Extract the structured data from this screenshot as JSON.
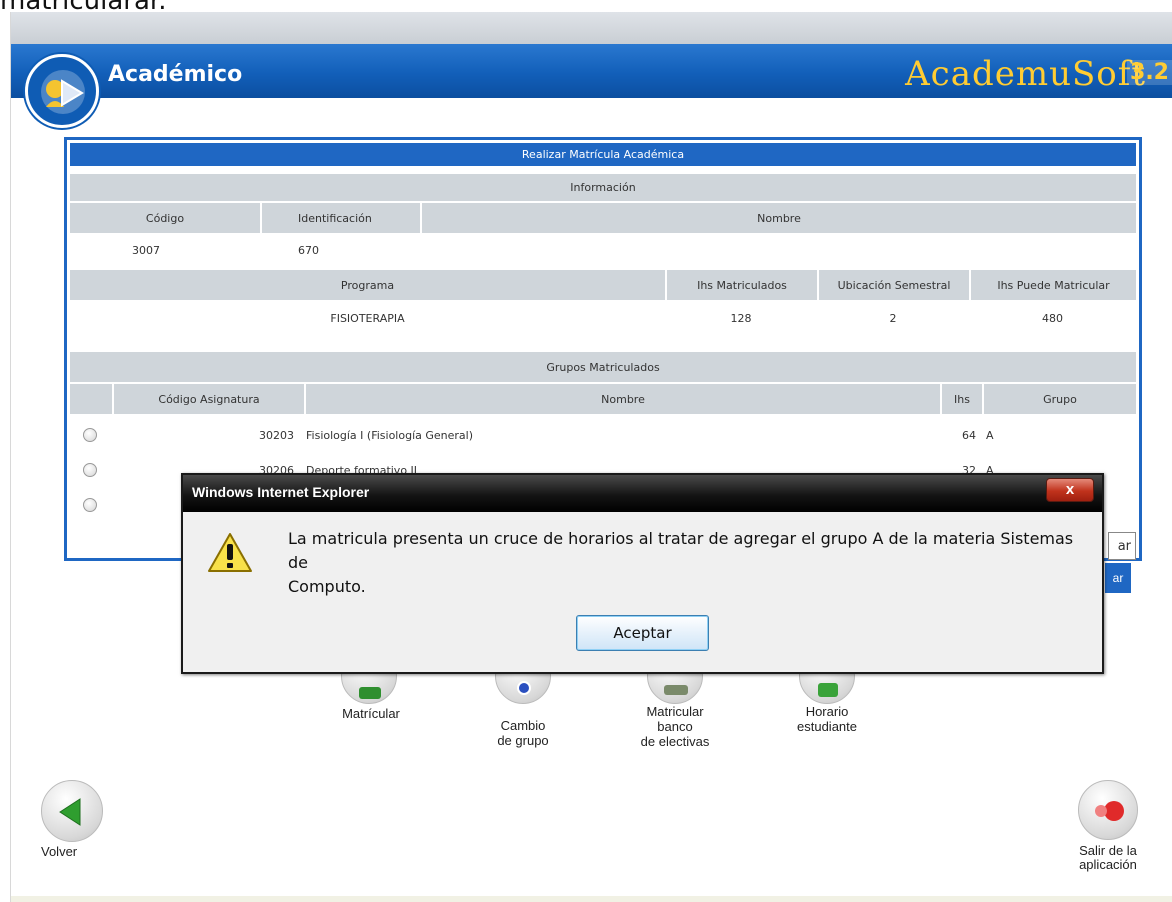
{
  "top_cut_text": "matricularar.",
  "header": {
    "title": "Académico",
    "brand": "AcademuSoft",
    "brand_version": "3.2"
  },
  "panel": {
    "title": "Realizar Matrícula Académica",
    "info_section": "Información",
    "columns_student": [
      "Código",
      "Identificación",
      "Nombre"
    ],
    "student": {
      "codigo": "3007",
      "identificacion": "670",
      "nombre": ""
    },
    "columns_program": [
      "Programa",
      "Ihs Matriculados",
      "Ubicación Semestral",
      "Ihs Puede Matricular"
    ],
    "program": {
      "programa": "FISIOTERAPIA",
      "ihs_matriculados": "128",
      "ubicacion": "2",
      "ihs_puede": "480"
    },
    "groups_section": "Grupos Matriculados",
    "columns_groups": [
      "Código Asignatura",
      "Nombre",
      "Ihs",
      "Grupo"
    ],
    "groups": [
      {
        "codigo": "30203",
        "nombre": "Fisiología I (Fisiología General)",
        "ihs": "64",
        "grupo": "A"
      },
      {
        "codigo": "30206",
        "nombre": "Deporte formativo II",
        "ihs": "32",
        "grupo": "A"
      }
    ],
    "cut_button_right": "ar",
    "cut_button_blue": "ar"
  },
  "actions": {
    "matricular": "Matrícular",
    "cambio_grupo_1": "Cambio",
    "cambio_grupo_2": "de grupo",
    "banco_1": "Matricular",
    "banco_2": "banco",
    "banco_3": "de electivas",
    "horario_1": "Horario",
    "horario_2": "estudiante"
  },
  "footer": {
    "volver": "Volver",
    "salir_1": "Salir de la",
    "salir_2": "aplicación"
  },
  "dialog": {
    "title": "Windows Internet Explorer",
    "close_symbol": "x",
    "message_line1": "La matricula presenta un cruce de horarios al tratar de agregar el grupo A de la materia Sistemas de",
    "message_line2": "Computo.",
    "ok_button": "Aceptar"
  },
  "colors": {
    "header_blue": "#125fb9",
    "panel_border": "#1f67c3",
    "header_cell": "#cfd5da",
    "brand_gold": "#ffcc33"
  }
}
